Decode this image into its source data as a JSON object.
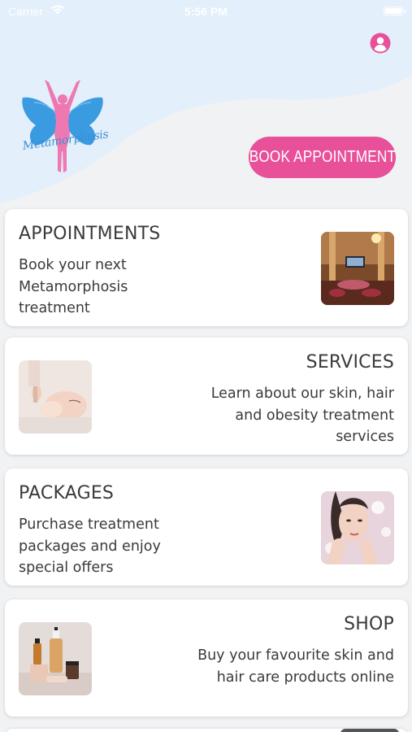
{
  "status_bar": {
    "carrier": "Carrier",
    "time": "5:56 PM"
  },
  "brand": {
    "logo_text": "Metamorphosis"
  },
  "header": {
    "book_button_label": "BOOK APPOINTMENT"
  },
  "cards": [
    {
      "title": "APPOINTMENTS",
      "description": "Book your next Metamorphosis treatment",
      "image": "clinic-interior"
    },
    {
      "title": "SERVICES",
      "description": "Learn about our skin, hair and obesity treatment services",
      "image": "facial-treatment"
    },
    {
      "title": "PACKAGES",
      "description": "Purchase treatment packages and enjoy special offers",
      "image": "woman-portrait"
    },
    {
      "title": "SHOP",
      "description": "Buy your favourite skin and hair care products online",
      "image": "skincare-bottles"
    }
  ],
  "colors": {
    "accent": "#e8509a",
    "hero_background": "#e3effa",
    "butterfly_blue": "#3b9be0",
    "page_background": "#f1f2f4"
  },
  "icons": [
    "wifi-icon",
    "battery-icon",
    "user-profile-icon",
    "butterfly-logo"
  ]
}
